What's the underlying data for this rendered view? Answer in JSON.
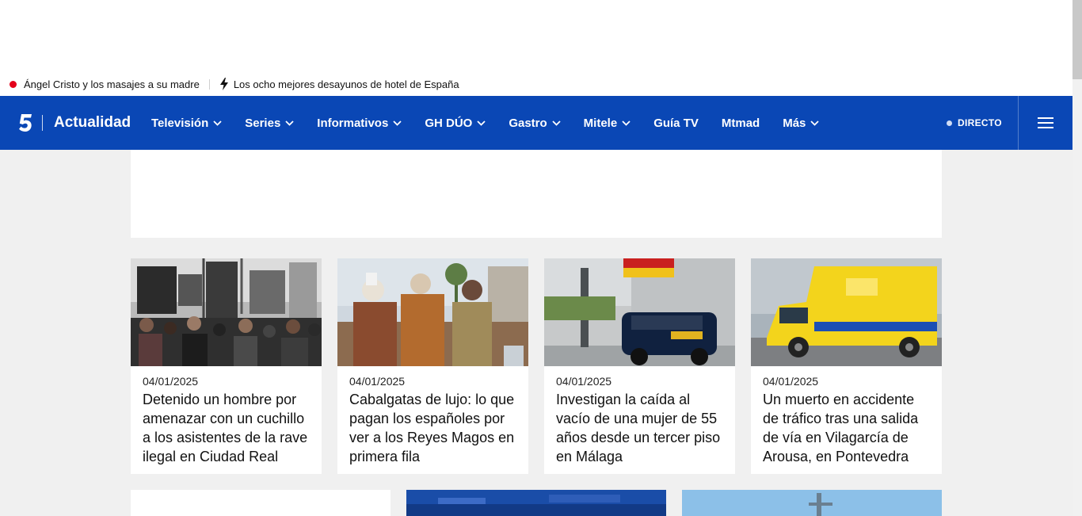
{
  "ticker": {
    "items": [
      {
        "label": "Ángel Cristo y los masajes a su madre"
      },
      {
        "label": "Los ocho mejores desayunos de hotel de España"
      }
    ]
  },
  "navbar": {
    "brand": "Actualidad",
    "items": [
      {
        "label": "Televisión"
      },
      {
        "label": "Series"
      },
      {
        "label": "Informativos"
      },
      {
        "label": "GH DÚO"
      },
      {
        "label": "Gastro"
      },
      {
        "label": "Mitele"
      },
      {
        "label": "Guía TV"
      },
      {
        "label": "Mtmad"
      },
      {
        "label": "Más"
      }
    ],
    "directo_label": "DIRECTO",
    "colors": {
      "background": "#0a47b5",
      "live_dot": "#e4001b"
    }
  },
  "cards": [
    {
      "date": "04/01/2025",
      "title": "Detenido un hombre por amenazar con un cuchillo a los asistentes de la rave ilegal en Ciudad Real"
    },
    {
      "date": "04/01/2025",
      "title": "Cabalgatas de lujo: lo que pagan los españoles por ver a los Reyes Magos en primera fila"
    },
    {
      "date": "04/01/2025",
      "title": "Investigan la caída al vacío de una mujer de 55 años desde un tercer piso en Málaga"
    },
    {
      "date": "04/01/2025",
      "title": "Un muerto en accidente de tráfico tras una salida de vía en Vilagarcía de Arousa, en Pontevedra"
    }
  ],
  "icons": {
    "ticker_live": "red-dot-icon",
    "ticker_trending": "lightning-bolt-icon",
    "nav_dropdown": "chevron-down-icon",
    "logo": "telecinco-5-logo-icon",
    "menu": "hamburger-menu-icon"
  }
}
